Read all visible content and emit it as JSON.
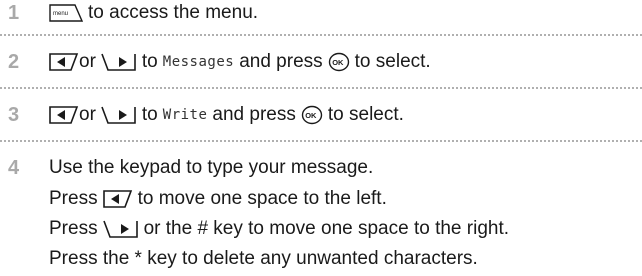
{
  "steps": [
    {
      "number": "1",
      "text_after_key": "to access the menu.",
      "menu_key_label": "menu"
    },
    {
      "number": "2",
      "or": "or",
      "to": "to",
      "target": "Messages",
      "and_press": "and press",
      "ok_key_label": "OK",
      "to_select": "to select."
    },
    {
      "number": "3",
      "or": "or",
      "to": "to",
      "target": "Write",
      "and_press": "and press",
      "ok_key_label": "OK",
      "to_select": "to select."
    },
    {
      "number": "4",
      "line1": "Use the keypad to type your message.",
      "line2_prefix": "Press",
      "line2_suffix": "to move one space to the left.",
      "line3_prefix": "Press",
      "line3_suffix": "or the # key to move one space to the right.",
      "line4": "Press the * key to delete any unwanted characters."
    }
  ],
  "icons": {
    "menu_key": "menu-softkey-icon",
    "left_key": "left-navigation-key-icon",
    "right_key": "right-navigation-key-icon",
    "ok_key": "ok-key-icon"
  },
  "colors": {
    "step_number": "#a9a9a9",
    "divider": "#b0b0b0",
    "text": "#1a1a1a"
  }
}
